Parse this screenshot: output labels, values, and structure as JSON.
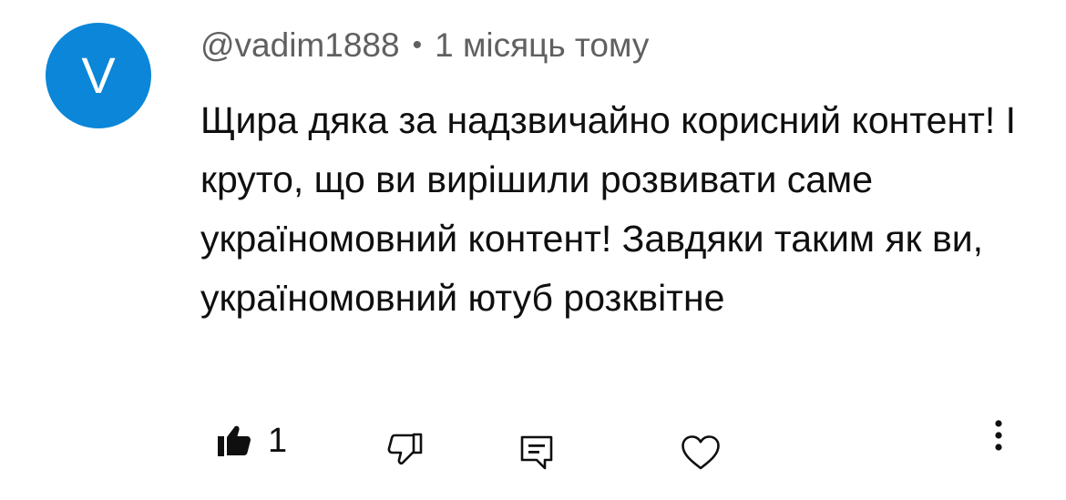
{
  "comment": {
    "avatar_letter": "V",
    "avatar_color": "#0b86d8",
    "username": "@vadim1888",
    "separator": "•",
    "timestamp": "1 місяць тому",
    "text": "Щира дяка за надзвичайно корисний контент! І круто, що ви вирішили розвивати саме україномовний контент! Завдяки таким як ви, україномовний ютуб розквітне"
  },
  "actions": {
    "like_count": "1",
    "like_icon": "thumbs-up-filled-icon",
    "dislike_icon": "thumbs-down-outline-icon",
    "reply_icon": "reply-comment-icon",
    "heart_icon": "heart-outline-icon",
    "more_icon": "vertical-ellipsis-icon"
  }
}
